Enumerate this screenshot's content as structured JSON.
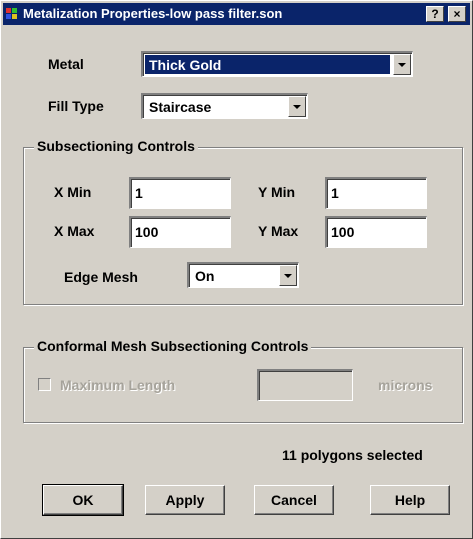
{
  "window": {
    "title": "Metalization Properties-low pass filter.son",
    "help_btn": "?",
    "close_btn": "×"
  },
  "metal": {
    "label": "Metal",
    "value": "Thick Gold"
  },
  "fill_type": {
    "label": "Fill Type",
    "value": "Staircase"
  },
  "subsectioning": {
    "legend": "Subsectioning Controls",
    "x_min": {
      "label": "X Min",
      "value": "1"
    },
    "y_min": {
      "label": "Y Min",
      "value": "1"
    },
    "x_max": {
      "label": "X Max",
      "value": "100"
    },
    "y_max": {
      "label": "Y Max",
      "value": "100"
    },
    "edge_mesh": {
      "label": "Edge Mesh",
      "value": "On"
    }
  },
  "conformal": {
    "legend": "Conformal Mesh Subsectioning Controls",
    "max_length_label": "Maximum Length",
    "max_length_value": "",
    "units": "microns"
  },
  "status": "11 polygons selected",
  "buttons": {
    "ok": "OK",
    "apply": "Apply",
    "cancel": "Cancel",
    "help": "Help"
  },
  "colors": {
    "title_bar": "#0a246a",
    "face": "#d4d0c8",
    "selection": "#0a246a"
  }
}
